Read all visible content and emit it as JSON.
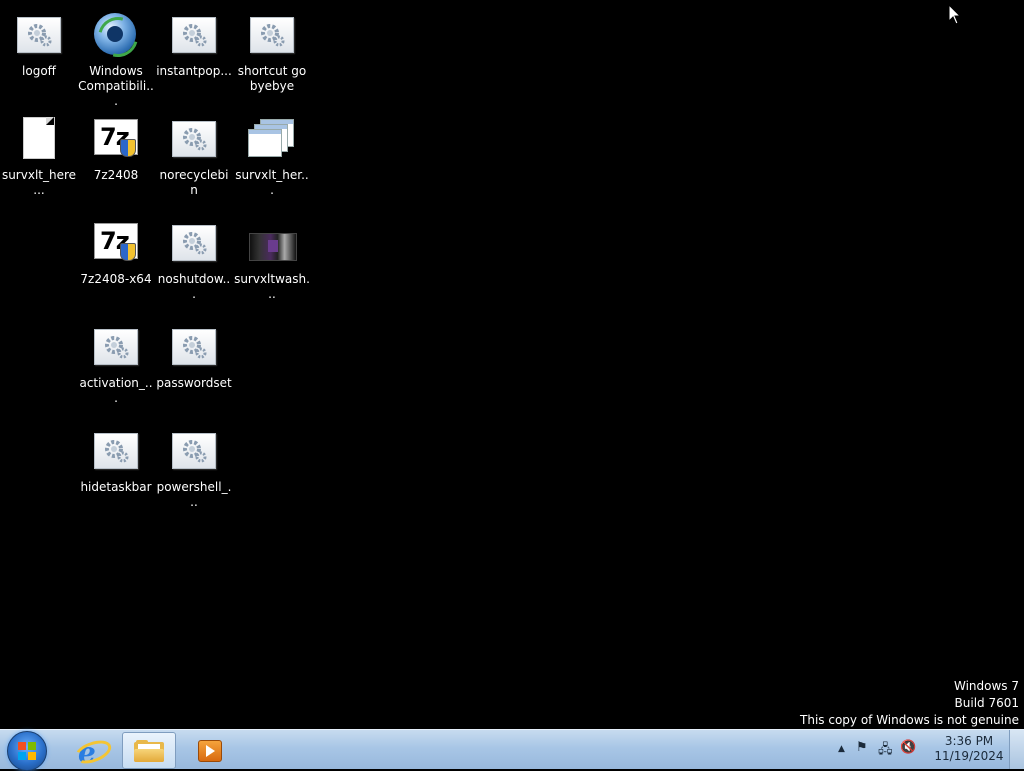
{
  "desktop": {
    "icons": [
      {
        "label": "logoff",
        "icon": "script-gear-icon"
      },
      {
        "label": "Windows Compatibili...",
        "icon": "windows-compatibility-icon"
      },
      {
        "label": "instantpop...",
        "icon": "script-gear-icon"
      },
      {
        "label": "shortcut go byebye",
        "icon": "script-gear-icon"
      },
      {
        "label": "survxlt_here...",
        "icon": "blank-document-icon"
      },
      {
        "label": "7z2408",
        "icon": "7zip-installer-icon"
      },
      {
        "label": "norecyclebin",
        "icon": "script-gear-icon"
      },
      {
        "label": "survxlt_her...",
        "icon": "stacked-windows-icon"
      },
      {
        "label": "7z2408-x64",
        "icon": "7zip-installer-icon"
      },
      {
        "label": "noshutdow...",
        "icon": "script-gear-icon"
      },
      {
        "label": "survxltwash...",
        "icon": "video-thumbnail-icon"
      },
      {
        "label": "activation_...",
        "icon": "script-gear-icon"
      },
      {
        "label": "passwordset",
        "icon": "script-gear-icon"
      },
      {
        "label": "hidetaskbar",
        "icon": "script-gear-icon"
      },
      {
        "label": "powershell_...",
        "icon": "script-gear-icon"
      }
    ]
  },
  "watermark": {
    "line1": "Windows 7",
    "line2": "Build 7601",
    "line3": "This copy of Windows is not genuine"
  },
  "taskbar": {
    "start_icon": "windows-start-orb-icon",
    "pinned": [
      {
        "name": "internet-explorer",
        "icon": "internet-explorer-icon"
      },
      {
        "name": "windows-explorer",
        "icon": "folder-icon",
        "active": true
      },
      {
        "name": "media-player",
        "icon": "media-player-icon"
      }
    ],
    "tray": {
      "time": "3:36 PM",
      "date": "11/19/2024"
    }
  }
}
